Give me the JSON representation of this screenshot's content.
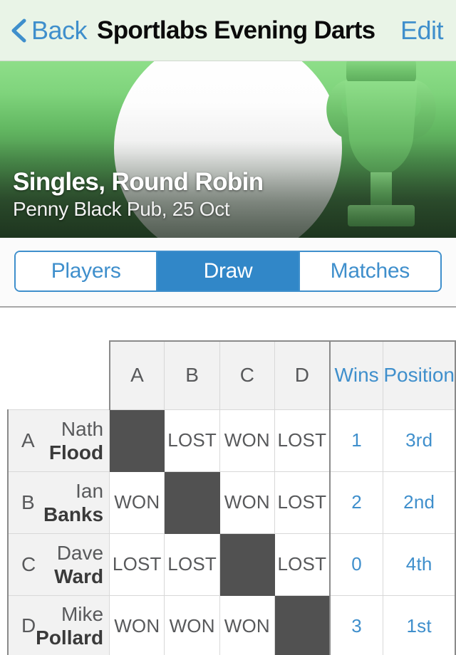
{
  "navbar": {
    "back_label": "Back",
    "title": "Sportlabs Evening Darts",
    "edit_label": "Edit",
    "back_icon": "chevron-left-icon",
    "tint_color": "#3f8fcc",
    "background_color": "#e9f4e7"
  },
  "hero": {
    "title": "Singles, Round Robin",
    "subtitle": "Penny Black Pub, 25 Oct",
    "trophy_icon": "trophy-icon",
    "share_icon": "share-icon",
    "photo_icon": "photo-icon",
    "gradient_top": "#8ede89",
    "gradient_bottom": "#2b4a2d"
  },
  "segmented": {
    "selected_index": 1,
    "accent_color": "#3187c8",
    "items": [
      {
        "label": "Players"
      },
      {
        "label": "Draw"
      },
      {
        "label": "Matches"
      }
    ]
  },
  "draw_table": {
    "accent_color": "#3f8fcc",
    "diagonal_color": "#515151",
    "column_headers": [
      "A",
      "B",
      "C",
      "D"
    ],
    "wins_header": "Wins",
    "position_header": "Position",
    "rows": [
      {
        "letter": "A",
        "first_name": "Nath",
        "last_name": "Flood",
        "results": [
          "",
          "LOST",
          "WON",
          "LOST"
        ],
        "diagonal_index": 0,
        "wins": "1",
        "position": "3rd"
      },
      {
        "letter": "B",
        "first_name": "Ian",
        "last_name": "Banks",
        "results": [
          "WON",
          "",
          "WON",
          "LOST"
        ],
        "diagonal_index": 1,
        "wins": "2",
        "position": "2nd"
      },
      {
        "letter": "C",
        "first_name": "Dave",
        "last_name": "Ward",
        "results": [
          "LOST",
          "LOST",
          "",
          "LOST"
        ],
        "diagonal_index": 2,
        "wins": "0",
        "position": "4th"
      },
      {
        "letter": "D",
        "first_name": "Mike",
        "last_name": "Pollard",
        "results": [
          "WON",
          "WON",
          "WON",
          ""
        ],
        "diagonal_index": 3,
        "wins": "3",
        "position": "1st"
      }
    ]
  }
}
